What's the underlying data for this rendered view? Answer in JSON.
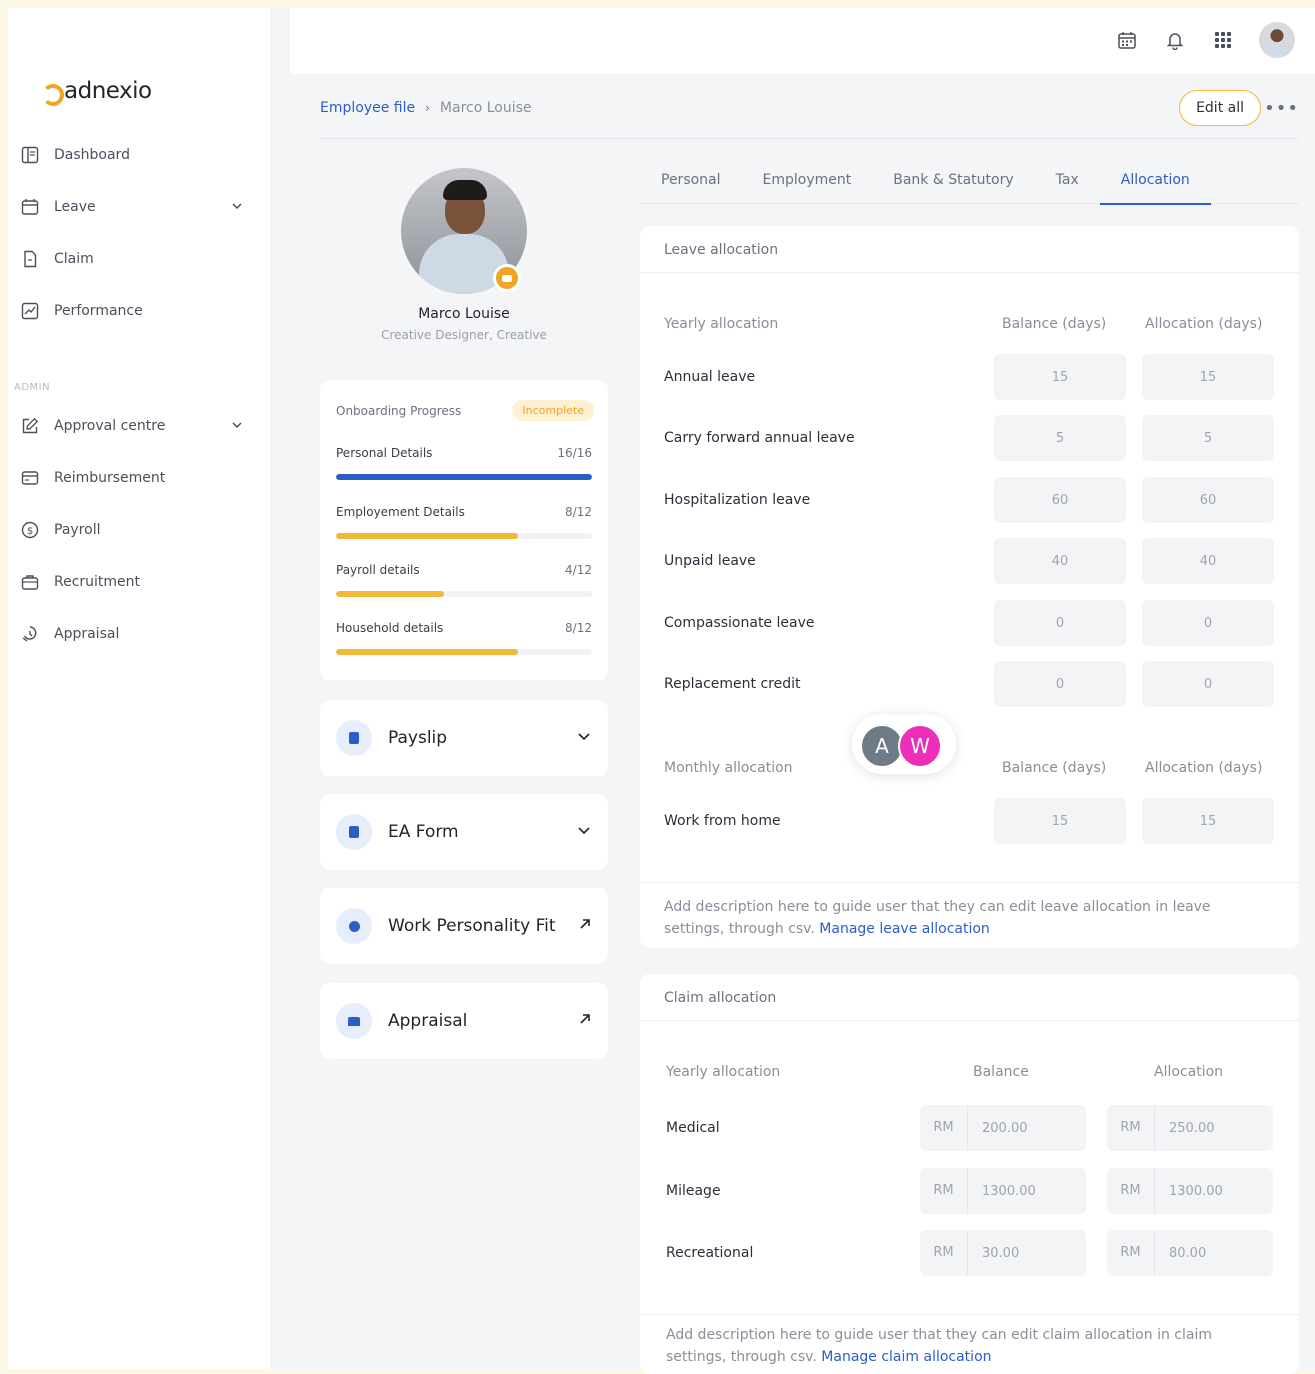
{
  "brand": {
    "name": "adnexio"
  },
  "sidebar": {
    "items": [
      {
        "label": "Dashboard",
        "icon": "dashboard-icon"
      },
      {
        "label": "Leave",
        "icon": "calendar-icon",
        "expandable": true
      },
      {
        "label": "Claim",
        "icon": "document-icon"
      },
      {
        "label": "Performance",
        "icon": "chart-icon"
      }
    ],
    "admin_label": "ADMIN",
    "admin_items": [
      {
        "label": "Approval centre",
        "icon": "edit-icon",
        "expandable": true
      },
      {
        "label": "Reimbursement",
        "icon": "card-icon"
      },
      {
        "label": "Payroll",
        "icon": "dollar-icon"
      },
      {
        "label": "Recruitment",
        "icon": "briefcase-icon"
      },
      {
        "label": "Appraisal",
        "icon": "appraisal-icon"
      }
    ]
  },
  "topbar": {
    "icons": [
      "calendar-icon",
      "bell-icon",
      "apps-grid-icon",
      "user-avatar"
    ]
  },
  "breadcrumb": {
    "parent": "Employee file",
    "current": "Marco Louise"
  },
  "actions": {
    "edit_all": "Edit all",
    "more": "•••"
  },
  "profile": {
    "name": "Marco Louise",
    "role": "Creative Designer, Creative"
  },
  "onboarding": {
    "title": "Onboarding Progress",
    "status": "Incomplete",
    "items": [
      {
        "label": "Personal Details",
        "count": "16/16",
        "progress": 1.0,
        "color": "#2b5fc7"
      },
      {
        "label": "Employement Details",
        "count": "8/12",
        "progress": 0.71,
        "color": "#f0b93a"
      },
      {
        "label": "Payroll details",
        "count": "4/12",
        "progress": 0.42,
        "color": "#f0b93a"
      },
      {
        "label": "Household details",
        "count": "8/12",
        "progress": 0.71,
        "color": "#f0b93a"
      }
    ]
  },
  "side_cards": [
    {
      "label": "Payslip",
      "arrow": "⌄"
    },
    {
      "label": "EA Form",
      "arrow": "⌄"
    },
    {
      "label": "Work Personality Fit",
      "arrow": "↗"
    },
    {
      "label": "Appraisal",
      "arrow": "↗"
    }
  ],
  "tabs": [
    "Personal",
    "Employment",
    "Bank & Statutory",
    "Tax",
    "Allocation"
  ],
  "active_tab": "Allocation",
  "leave": {
    "title": "Leave allocation",
    "yearly_label": "Yearly allocation",
    "col_balance": "Balance (days)",
    "col_allocation": "Allocation (days)",
    "rows": [
      {
        "label": "Annual leave",
        "balance": "15",
        "allocation": "15"
      },
      {
        "label": "Carry forward annual leave",
        "balance": "5",
        "allocation": "5"
      },
      {
        "label": "Hospitalization leave",
        "balance": "60",
        "allocation": "60"
      },
      {
        "label": "Unpaid leave",
        "balance": "40",
        "allocation": "40"
      },
      {
        "label": "Compassionate leave",
        "balance": "0",
        "allocation": "0"
      },
      {
        "label": "Replacement credit",
        "balance": "0",
        "allocation": "0"
      }
    ],
    "monthly_label": "Monthly allocation",
    "monthly_rows": [
      {
        "label": "Work from home",
        "balance": "15",
        "allocation": "15"
      }
    ],
    "desc": "Add description here to guide user that they can edit leave allocation in leave settings, through csv.",
    "link": "Manage leave allocation"
  },
  "claim": {
    "title": "Claim allocation",
    "yearly_label": "Yearly allocation",
    "col_balance": "Balance",
    "col_allocation": "Allocation",
    "currency": "RM",
    "rows": [
      {
        "label": "Medical",
        "balance": "200.00",
        "allocation": "250.00"
      },
      {
        "label": "Mileage",
        "balance": "1300.00",
        "allocation": "1300.00"
      },
      {
        "label": "Recreational",
        "balance": "30.00",
        "allocation": "80.00"
      }
    ],
    "desc": "Add description here to guide user that they can edit claim allocation in claim settings, through csv.",
    "link": "Manage claim allocation"
  },
  "presence": [
    {
      "initial": "A",
      "color": "#6f7b86"
    },
    {
      "initial": "W",
      "color": "#ec2fb6"
    }
  ]
}
